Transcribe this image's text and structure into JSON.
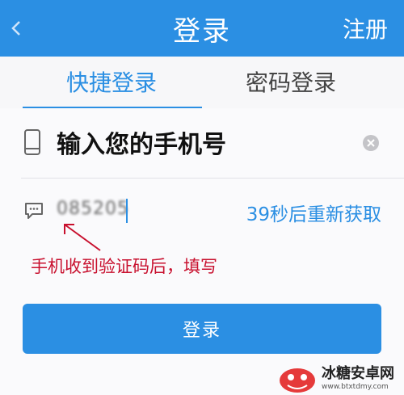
{
  "header": {
    "back_icon": "chevron-left-icon",
    "title": "登录",
    "register_label": "注册"
  },
  "tabs": [
    {
      "label": "快捷登录",
      "active": true
    },
    {
      "label": "密码登录",
      "active": false
    }
  ],
  "phone_field": {
    "icon": "phone-icon",
    "placeholder_text": "输入您的手机号",
    "clear_icon": "clear-icon"
  },
  "code_field": {
    "icon": "message-icon",
    "value": "085205",
    "resend_label": "39秒后重新获取"
  },
  "annotation": {
    "text": "手机收到验证码后，填写"
  },
  "login_button": {
    "label": "登录"
  },
  "watermark": {
    "title": "冰糖安卓网",
    "url": "www.btxtdmy.com"
  },
  "colors": {
    "accent": "#2b8fe3",
    "annotation": "#c8102e",
    "background": "#efeff2"
  }
}
